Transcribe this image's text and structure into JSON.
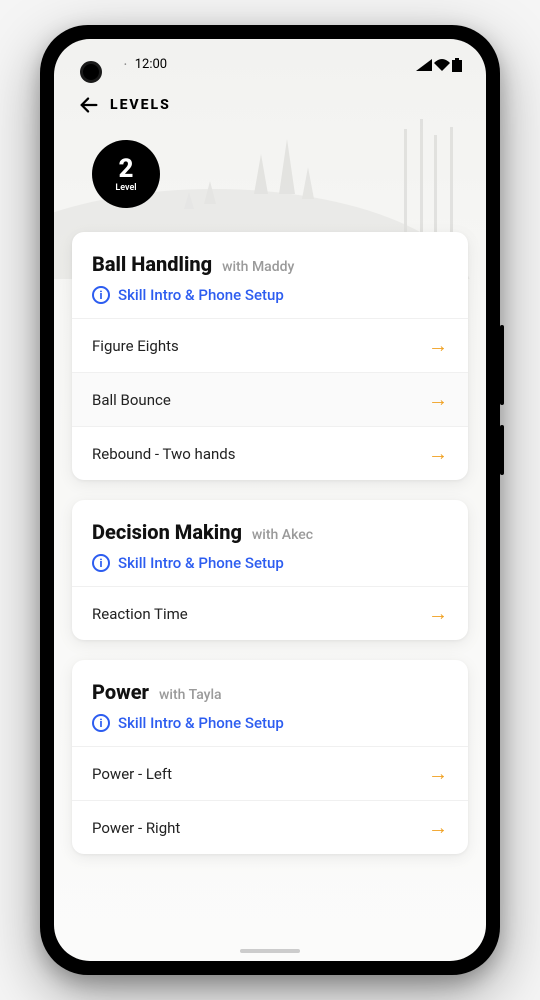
{
  "status": {
    "time": "12:00"
  },
  "header": {
    "back_label": "LEVELS"
  },
  "level": {
    "number": "2",
    "label": "Level"
  },
  "intro_label": "Skill Intro & Phone Setup",
  "sections": [
    {
      "title": "Ball Handling",
      "with": "with Maddy",
      "items": [
        {
          "name": "Figure Eights"
        },
        {
          "name": "Ball Bounce"
        },
        {
          "name": "Rebound - Two hands"
        }
      ]
    },
    {
      "title": "Decision Making",
      "with": "with Akec",
      "items": [
        {
          "name": "Reaction Time"
        }
      ]
    },
    {
      "title": "Power",
      "with": "with Tayla",
      "items": [
        {
          "name": "Power - Left"
        },
        {
          "name": "Power - Right"
        }
      ]
    }
  ]
}
